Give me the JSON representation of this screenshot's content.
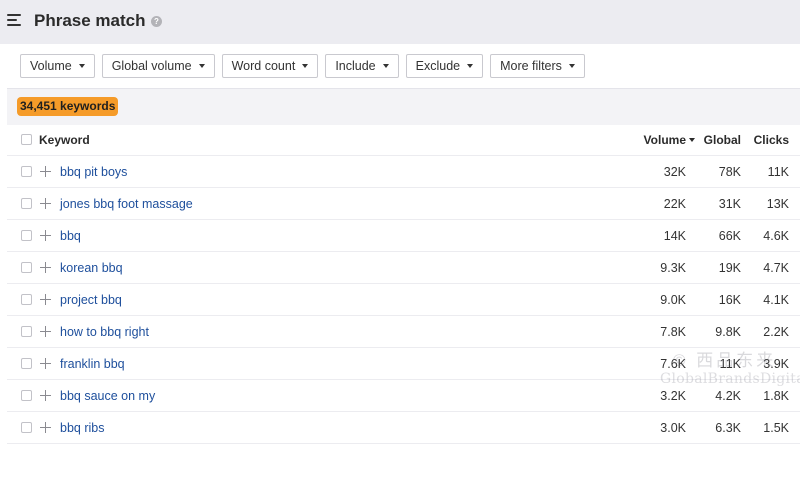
{
  "header": {
    "title": "Phrase match",
    "help": "?"
  },
  "filters": [
    {
      "label": "Volume"
    },
    {
      "label": "Global volume"
    },
    {
      "label": "Word count"
    },
    {
      "label": "Include"
    },
    {
      "label": "Exclude"
    },
    {
      "label": "More filters"
    }
  ],
  "count_badge": "34,451 keywords",
  "table": {
    "headers": {
      "keyword": "Keyword",
      "volume": "Volume",
      "global": "Global",
      "clicks": "Clicks"
    },
    "rows": [
      {
        "keyword": "bbq pit boys",
        "volume": "32K",
        "global": "78K",
        "clicks": "11K"
      },
      {
        "keyword": "jones bbq foot massage",
        "volume": "22K",
        "global": "31K",
        "clicks": "13K"
      },
      {
        "keyword": "bbq",
        "volume": "14K",
        "global": "66K",
        "clicks": "4.6K"
      },
      {
        "keyword": "korean bbq",
        "volume": "9.3K",
        "global": "19K",
        "clicks": "4.7K"
      },
      {
        "keyword": "project bbq",
        "volume": "9.0K",
        "global": "16K",
        "clicks": "4.1K"
      },
      {
        "keyword": "how to bbq right",
        "volume": "7.8K",
        "global": "9.8K",
        "clicks": "2.2K"
      },
      {
        "keyword": "franklin bbq",
        "volume": "7.6K",
        "global": "11K",
        "clicks": "3.9K"
      },
      {
        "keyword": "bbq sauce on my",
        "volume": "3.2K",
        "global": "4.2K",
        "clicks": "1.8K"
      },
      {
        "keyword": "bbq ribs",
        "volume": "3.0K",
        "global": "6.3K",
        "clicks": "1.5K"
      }
    ]
  },
  "watermark": {
    "logo": "© 西品东来",
    "text": "GlobalBrandsDigital"
  },
  "colors": {
    "badge": "#f59b29",
    "link": "#1e4f9c",
    "topbar": "#ececf1"
  },
  "icons": {
    "menu": "hamburger-menu-icon",
    "help": "help-icon",
    "row_add": "plus-icon",
    "dropdown": "caret-down-icon"
  }
}
